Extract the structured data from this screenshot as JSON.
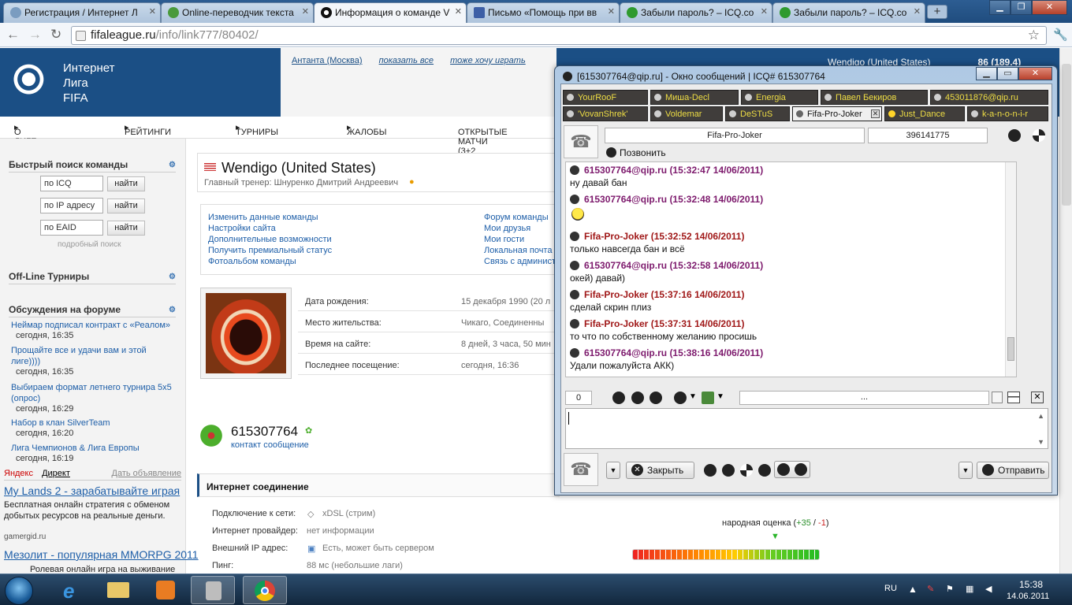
{
  "browser": {
    "tabs": [
      {
        "label": "Регистрация / Интернет Л",
        "active": false
      },
      {
        "label": "Online-переводчик текста",
        "active": false
      },
      {
        "label": "Информация о команде V",
        "active": true
      },
      {
        "label": "Письмо «Помощь при вв",
        "active": false
      },
      {
        "label": "Забыли пароль? – ICQ.co",
        "active": false
      },
      {
        "label": "Забыли пароль? – ICQ.co",
        "active": false
      }
    ],
    "url_domain": "fifaleague.ru",
    "url_path": "/info/link777/80402/"
  },
  "site": {
    "logo_text": [
      "Интернет",
      "Лига",
      "FIFA"
    ],
    "header_links": [
      "Антанта (Москва)",
      "показать все",
      "тоже хочу играть"
    ],
    "header_right_team": "Wendigo (United States)",
    "header_right_score": "86 (189.4)",
    "menu": [
      "О ЛИГЕ",
      "РЕЙТИНГИ",
      "ТУРНИРЫ",
      "ЖАЛОБЫ",
      "ОТКРЫТЫЕ МАТЧИ (3+2"
    ],
    "sidebar": {
      "quick_search_title": "Быстрый поиск команды",
      "search_fields": [
        "по ICQ",
        "по IP адресу",
        "по EAID"
      ],
      "search_button": "найти",
      "advanced_search": "подробный поиск",
      "offline_title": "Off-Line Турниры",
      "forum_title": "Обсуждения на форуме",
      "forum_items": [
        {
          "title": "Неймар подписал контракт с «Реалом»",
          "time": "сегодня, 16:35"
        },
        {
          "title": "Прощайте все и удачи вам и этой лиге))))",
          "time": "сегодня, 16:35"
        },
        {
          "title": "Выбираем формат летнего турнира 5x5 (опрос)",
          "time": "сегодня, 16:29"
        },
        {
          "title": "Набор в клан SilverTeam",
          "time": "сегодня, 16:20"
        },
        {
          "title": "Лига Чемпионов & Лига Европы",
          "time": "сегодня, 16:19"
        }
      ],
      "yandex": "Яндекс",
      "direct": "Директ",
      "ad_link": "Дать объявление",
      "ads": [
        {
          "title": "My Lands 2 - зарабатывайте играя",
          "text": "Бесплатная онлайн стратегия с обменом добытых ресурсов на реальные деньги.",
          "domain": "gamergid.ru"
        },
        {
          "title": "Мезолит - популярная MMORPG 2011",
          "text": "Ролевая онлайн игра на выживание"
        }
      ]
    },
    "team": {
      "name": "Wendigo (United States)",
      "coach": "Главный тренер: Шнуренко Дмитрий Андреевич"
    },
    "links_left": [
      "Изменить данные команды",
      "Настройки сайта",
      "Дополнительные возможности",
      "Получить премиальный статус",
      "Фотоальбом команды"
    ],
    "links_right": [
      "Форум команды",
      "Мои друзья",
      "Мои гости",
      "Локальная почта",
      "Связь с админист"
    ],
    "profile_rows": [
      {
        "label": "Дата рождения:",
        "value": "15 декабря 1990 (20 л"
      },
      {
        "label": "Место жительства:",
        "value": "Чикаго, Соединенны"
      },
      {
        "label": "Время на сайте:",
        "value": "8 дней, 3 часа, 50 мин"
      },
      {
        "label": "Последнее посещение:",
        "value": "сегодня, 16:36"
      }
    ],
    "icq_number": "615307764",
    "icq_links": "контакт сообщение",
    "net_title": "Интернет соединение",
    "net_rows": [
      {
        "label": "Подключение к сети:",
        "value": "xDSL (стрим)"
      },
      {
        "label": "Интернет провайдер:",
        "value": "нет информации"
      },
      {
        "label": "Внешний IP адрес:",
        "value": "Есть, может быть сервером"
      },
      {
        "label": "Пинг:",
        "value": "88 мс (небольшие лаги)"
      }
    ],
    "rating_label": "народная оценка",
    "rating_plus": "+35",
    "rating_minus": "-1"
  },
  "icq": {
    "title": "[615307764@qip.ru] - Окно сообщений | ICQ# 615307764",
    "tabs_row1": [
      "YourRooF",
      "Миша-Decl",
      "Energia",
      "Павел Бекиров",
      "453011876@qip.ru"
    ],
    "tabs_row2": [
      "'VovanShrek'",
      "Voldemar",
      "DeSTuS",
      "Fifa-Pro-Joker",
      "Just_Dance",
      "k-a-n-o-n-i-r"
    ],
    "contact_name": "Fifa-Pro-Joker",
    "contact_uin": "396141775",
    "call_label": "Позвонить",
    "messages": [
      {
        "from": "615307764@qip.ru",
        "time": "(15:32:47 14/06/2011)",
        "text": "ну давай бан",
        "own": true
      },
      {
        "from": "615307764@qip.ru",
        "time": "(15:32:48 14/06/2011)",
        "text": "",
        "own": true
      },
      {
        "from": "Fifa-Pro-Joker",
        "time": "(15:32:52 14/06/2011)",
        "text": "только навсегда бан и всё",
        "own": false
      },
      {
        "from": "615307764@qip.ru",
        "time": "(15:32:58 14/06/2011)",
        "text": "окей) давай)",
        "own": true
      },
      {
        "from": "Fifa-Pro-Joker",
        "time": "(15:37:16 14/06/2011)",
        "text": "сделай скрин плиз",
        "own": false
      },
      {
        "from": "Fifa-Pro-Joker",
        "time": "(15:37:31 14/06/2011)",
        "text": "то что по собственному желанию просишь",
        "own": false
      },
      {
        "from": "615307764@qip.ru",
        "time": "(15:38:16 14/06/2011)",
        "text": "Удали пожалуйста АКК)",
        "own": true
      }
    ],
    "char_count": "0",
    "status_ellipsis": "...",
    "close_button": "Закрыть",
    "send_button": "Отправить"
  },
  "taskbar": {
    "lang": "RU",
    "time": "15:38",
    "date": "14.06.2011"
  }
}
